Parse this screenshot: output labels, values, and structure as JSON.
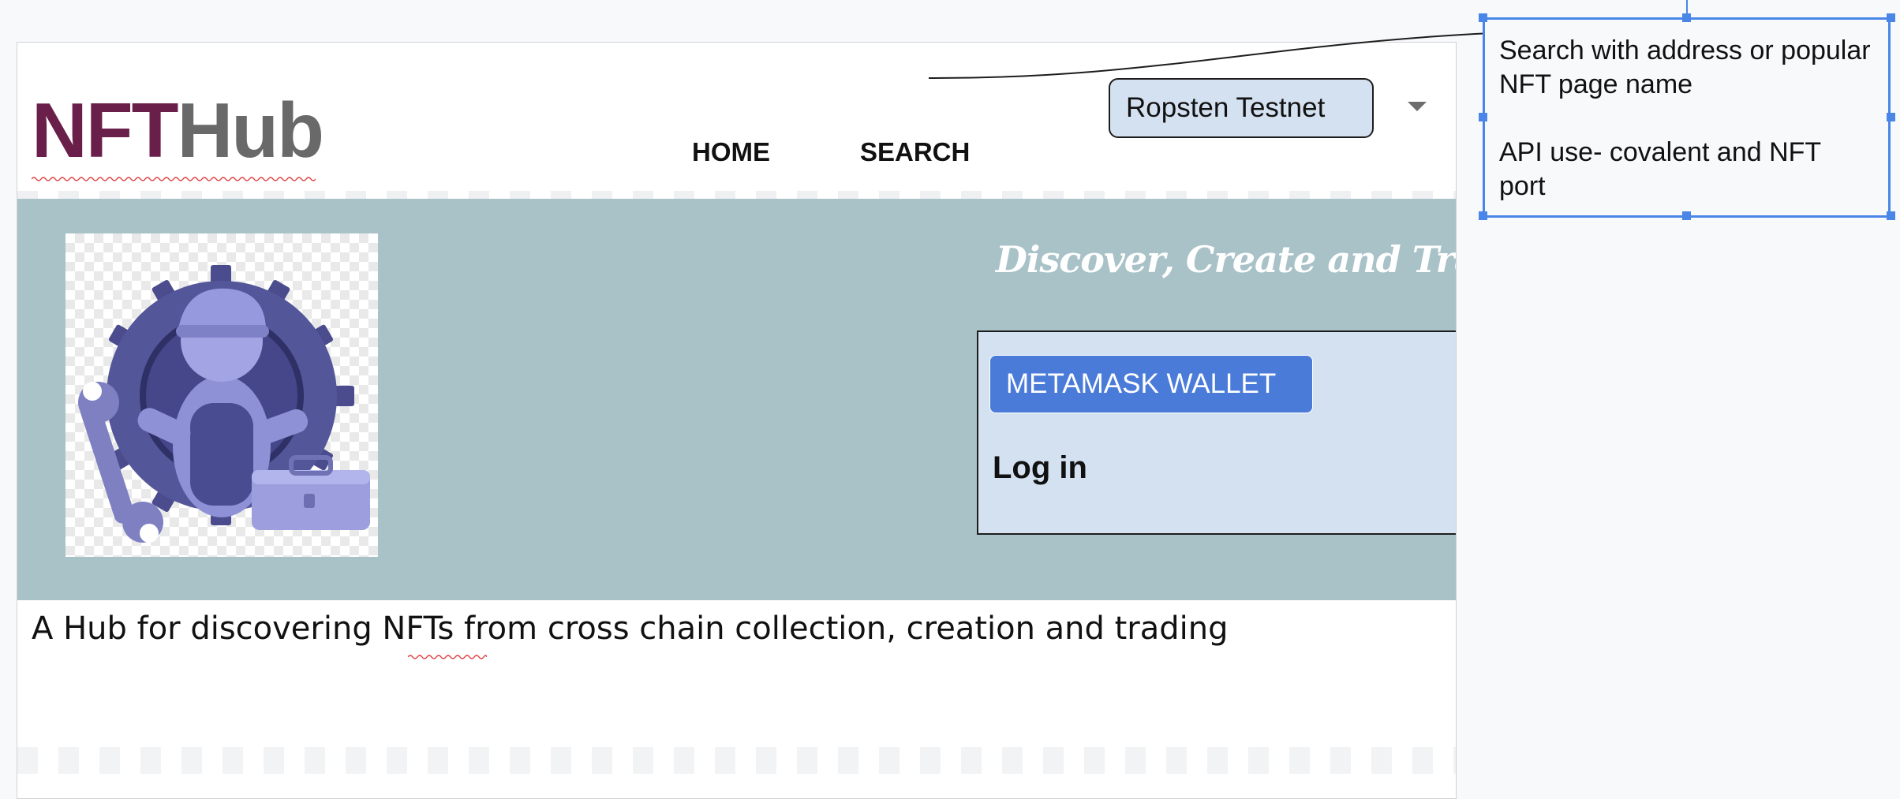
{
  "header": {
    "logo": {
      "part1": "NFT",
      "part2": "Hub"
    },
    "nav": {
      "home": "HOME",
      "search": "SEARCH"
    },
    "network": {
      "selected": "Ropsten Testnet"
    }
  },
  "hero": {
    "tagline": "Discover, Create and Trade",
    "login": {
      "wallet_button": "METAMASK WALLET",
      "heading": "Log in"
    }
  },
  "description": "A Hub for discovering NFTs from cross chain collection, creation and trading",
  "annotation": {
    "line1": "Search with address or popular NFT page name",
    "line2": "API use- covalent and NFT port"
  },
  "colors": {
    "logo_primary": "#6a1f4a",
    "logo_secondary": "#696969",
    "hero_background": "#a8c2c7",
    "panel_background": "#d4e1f1",
    "wallet_button": "#4a7bd8",
    "selection_accent": "#4a86e8"
  },
  "icons": {
    "hero_image": "mechanic-gear-illustration",
    "network_caret": "caret-down-icon"
  }
}
